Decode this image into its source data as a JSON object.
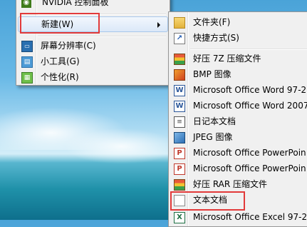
{
  "context_menu": {
    "items": [
      {
        "label": "NVIDIA 控制面板",
        "icon": "nvidia-icon"
      },
      {
        "label": "新建(W)",
        "icon": "",
        "has_submenu": true
      },
      {
        "label": "屏幕分辨率(C)",
        "icon": "display-icon"
      },
      {
        "label": "小工具(G)",
        "icon": "gadgets-icon"
      },
      {
        "label": "个性化(R)",
        "icon": "personalize-icon"
      }
    ]
  },
  "new_submenu": {
    "items": [
      {
        "label": "文件夹(F)",
        "icon": "folder-icon"
      },
      {
        "label": "快捷方式(S)",
        "icon": "shortcut-icon"
      },
      {
        "label": "好压 7Z 压缩文件",
        "icon": "archive-icon"
      },
      {
        "label": "BMP 图像",
        "icon": "image-icon"
      },
      {
        "label": "Microsoft Office Word 97-2",
        "icon": "word-icon"
      },
      {
        "label": "Microsoft Office Word 2007",
        "icon": "word-icon"
      },
      {
        "label": "日记本文档",
        "icon": "journal-icon"
      },
      {
        "label": "JPEG 图像",
        "icon": "image-icon"
      },
      {
        "label": "Microsoft Office PowerPoin",
        "icon": "powerpoint-icon"
      },
      {
        "label": "Microsoft Office PowerPoin",
        "icon": "powerpoint-icon"
      },
      {
        "label": "好压 RAR 压缩文件",
        "icon": "archive-icon"
      },
      {
        "label": "文本文档",
        "icon": "text-document-icon"
      },
      {
        "label": "Microsoft Office Excel 97-2",
        "icon": "excel-icon"
      }
    ]
  },
  "colors": {
    "menu_bg": "#f0f0f0",
    "highlight_box": "#e23a3a",
    "menu_border": "#979797"
  }
}
